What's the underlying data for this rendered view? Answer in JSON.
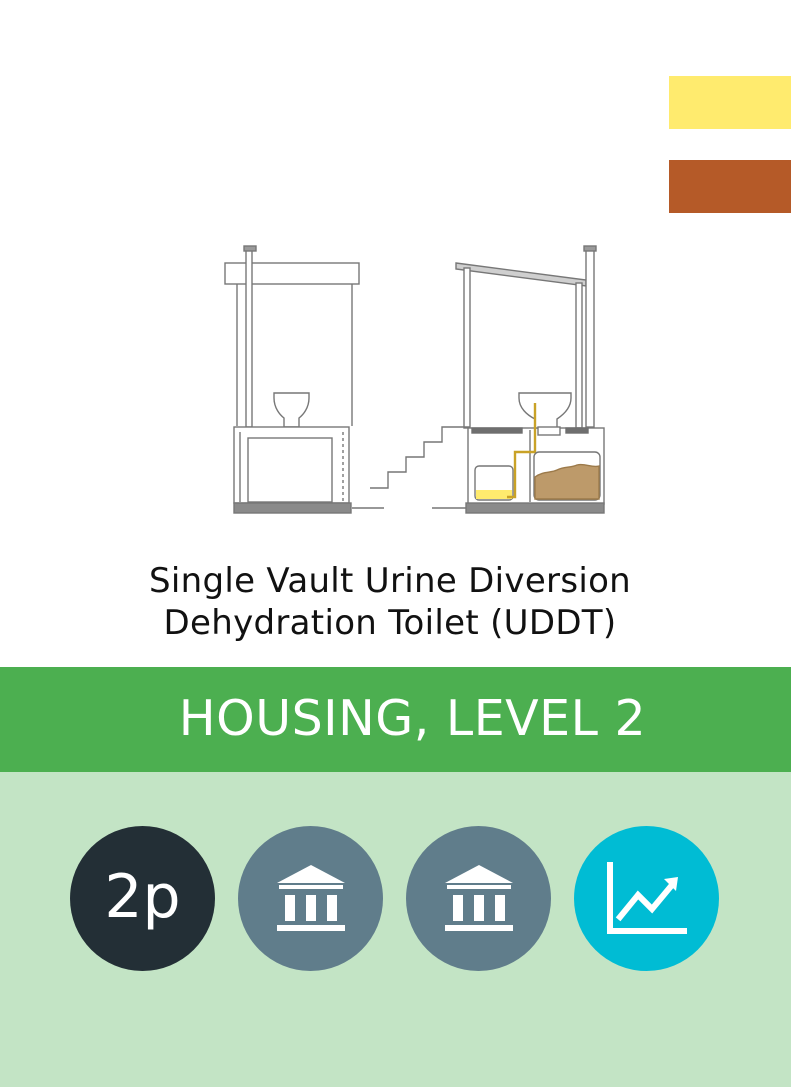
{
  "swatches": {
    "urine_color": "#ffeb6e",
    "feces_color": "#b55a28"
  },
  "title": {
    "line1": "Single Vault Urine Diversion",
    "line2": "Dehydration Toilet (UDDT)"
  },
  "level": {
    "label": "HOUSING, LEVEL 2",
    "color": "#4caf50"
  },
  "background": {
    "lower_color": "#c3e4c5"
  },
  "badges": [
    {
      "kind": "persons",
      "label": "2p",
      "icon": "",
      "color": "#232f36"
    },
    {
      "kind": "institution",
      "label": "",
      "icon": "institution-icon",
      "color": "#607d8b"
    },
    {
      "kind": "institution",
      "label": "",
      "icon": "institution-icon",
      "color": "#607d8b"
    },
    {
      "kind": "trend",
      "label": "",
      "icon": "trend-chart-icon",
      "color": "#00bcd4"
    }
  ]
}
